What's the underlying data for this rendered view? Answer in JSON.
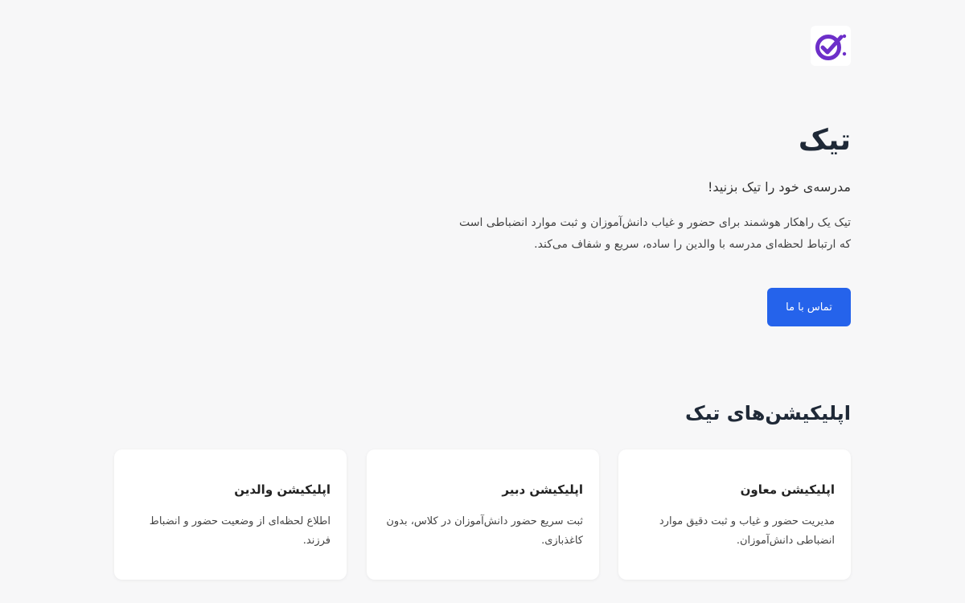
{
  "brand": {
    "logo_icon": "tik-checkmark-logo-icon",
    "accent_color": "#6d2fc9"
  },
  "hero": {
    "title": "تیک",
    "tagline": "مدرسه‌ی خود را تیک بزنید!",
    "description": "تیک یک راهکار هوشمند برای حضور و غیاب دانش‌آموزان و ثبت موارد انضباطی است که ارتباط لحظه‌ای مدرسه با والدین را ساده، سریع و شفاف می‌کند.",
    "cta_label": "تماس با ما",
    "cta_color": "#2563eb"
  },
  "apps": {
    "title": "اپلیکیشن‌های تیک",
    "cards": [
      {
        "title": "اپلیکیشن معاون",
        "description": "مدیریت حضور و غیاب و ثبت دقیق موارد انضباطی دانش‌آموزان."
      },
      {
        "title": "اپلیکیشن دبیر",
        "description": "ثبت سریع حضور دانش‌آموزان در کلاس، بدون کاغذبازی."
      },
      {
        "title": "اپلیکیشن والدین",
        "description": "اطلاع لحظه‌ای از وضعیت حضور و انضباط فرزند."
      }
    ]
  }
}
